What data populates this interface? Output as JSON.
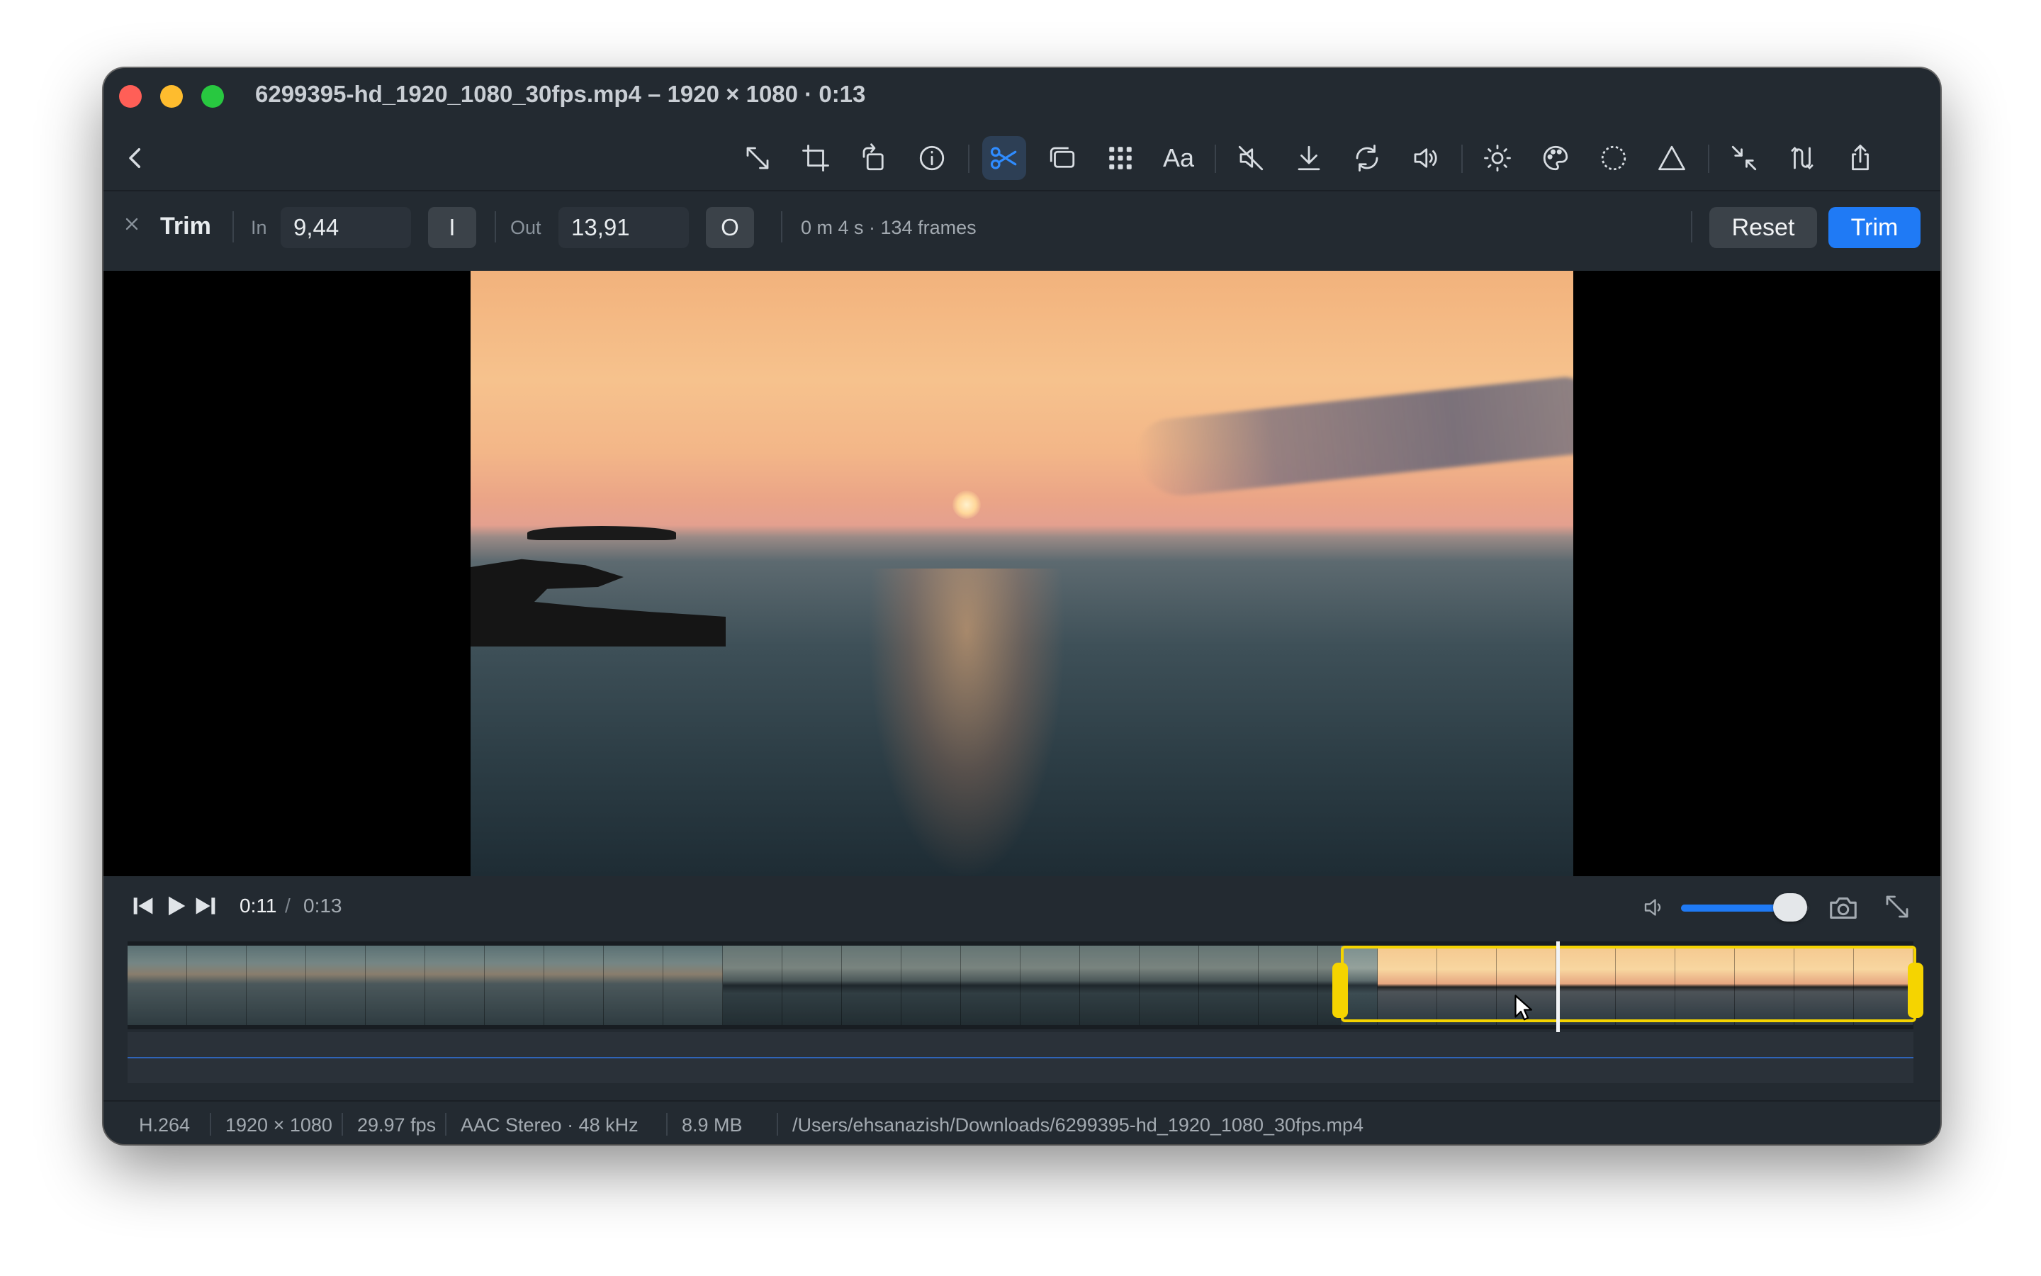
{
  "window": {
    "title": "6299395-hd_1920_1080_30fps.mp4 – 1920 × 1080 · 0:13"
  },
  "toolbar": {
    "text_tool_label": "Aa",
    "tools": [
      "back-icon",
      "resize-icon",
      "crop-icon",
      "rotate-icon",
      "info-icon",
      "scissors-icon",
      "overlay-icon",
      "grid-icon",
      "text-icon",
      "mute-icon",
      "download-icon",
      "loop-icon",
      "volume-icon",
      "brightness-icon",
      "palette-icon",
      "circle-dashed-icon",
      "triangle-icon",
      "compress-icon",
      "audio-adjust-icon",
      "share-icon"
    ],
    "active_tool": "scissors-icon"
  },
  "trim": {
    "label": "Trim",
    "in_label": "In",
    "in_value": "9,44",
    "in_key": "I",
    "out_label": "Out",
    "out_value": "13,91",
    "out_key": "O",
    "duration_info": "0 m 4 s · 134 frames",
    "reset_label": "Reset",
    "trim_label": "Trim"
  },
  "player": {
    "current_time": "0:11",
    "separator": "/",
    "total_time": "0:13",
    "volume_level": 0.92
  },
  "timeline": {
    "selection_start": 0.677,
    "selection_end": 1.0,
    "playhead": 0.8
  },
  "status": {
    "codec": "H.264",
    "resolution": "1920 × 1080",
    "fps": "29.97 fps",
    "audio": "AAC Stereo · 48 kHz",
    "size": "8.9 MB",
    "path": "/Users/ehsanazish/Downloads/6299395-hd_1920_1080_30fps.mp4"
  },
  "colors": {
    "accent": "#1f7af5",
    "selection": "#f5d400",
    "window_bg": "#232a31"
  }
}
